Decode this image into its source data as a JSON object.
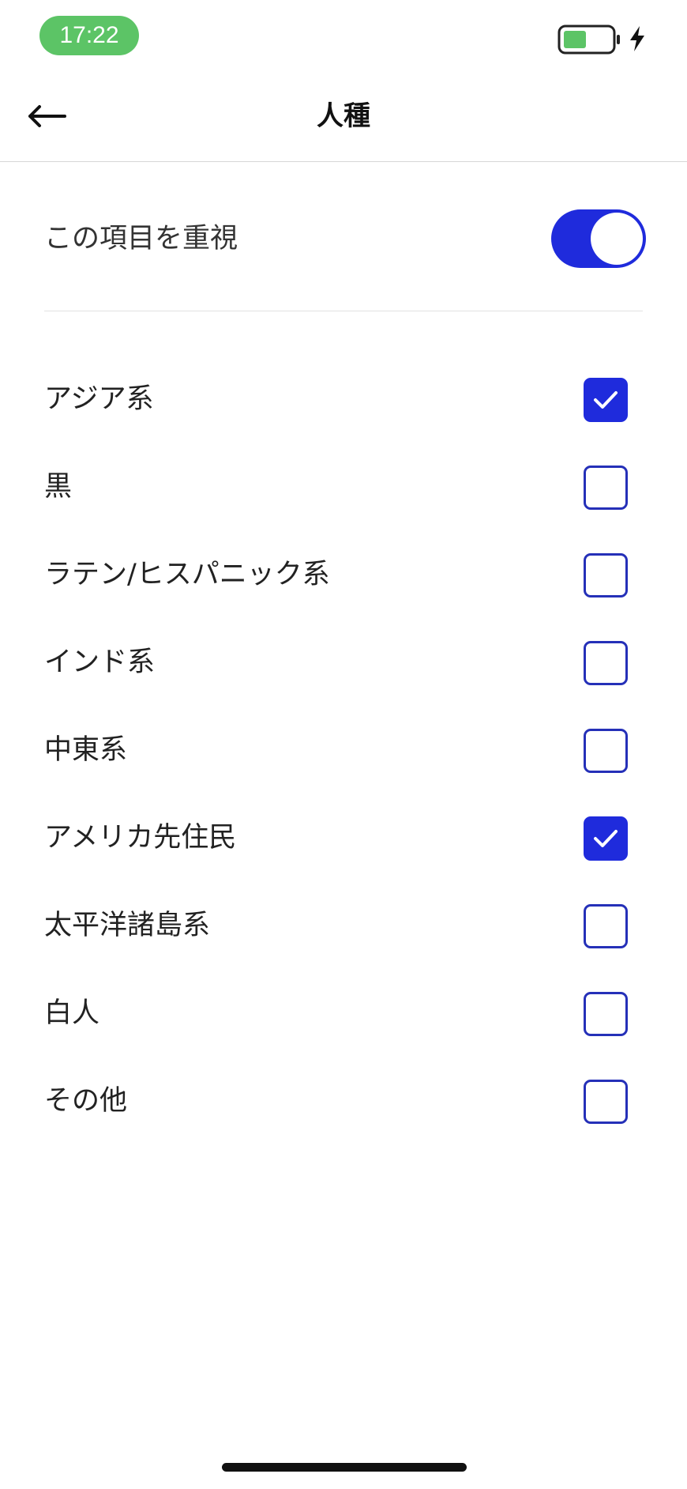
{
  "status_bar": {
    "time": "17:22",
    "time_pill_color": "#5cc466",
    "battery_icon": "battery-charging-icon",
    "bolt_icon": "charging-bolt-icon"
  },
  "nav": {
    "back_icon": "arrow-left-icon",
    "title": "人種"
  },
  "priority": {
    "label": "この項目を重視",
    "enabled": true
  },
  "colors": {
    "accent": "#1f2bdc",
    "checkbox_border": "#2530b8"
  },
  "options": [
    {
      "label": "アジア系",
      "checked": true
    },
    {
      "label": "黒",
      "checked": false
    },
    {
      "label": "ラテン/ヒスパニック系",
      "checked": false
    },
    {
      "label": "インド系",
      "checked": false
    },
    {
      "label": "中東系",
      "checked": false
    },
    {
      "label": "アメリカ先住民",
      "checked": true
    },
    {
      "label": "太平洋諸島系",
      "checked": false
    },
    {
      "label": "白人",
      "checked": false
    },
    {
      "label": "その他",
      "checked": false
    }
  ]
}
